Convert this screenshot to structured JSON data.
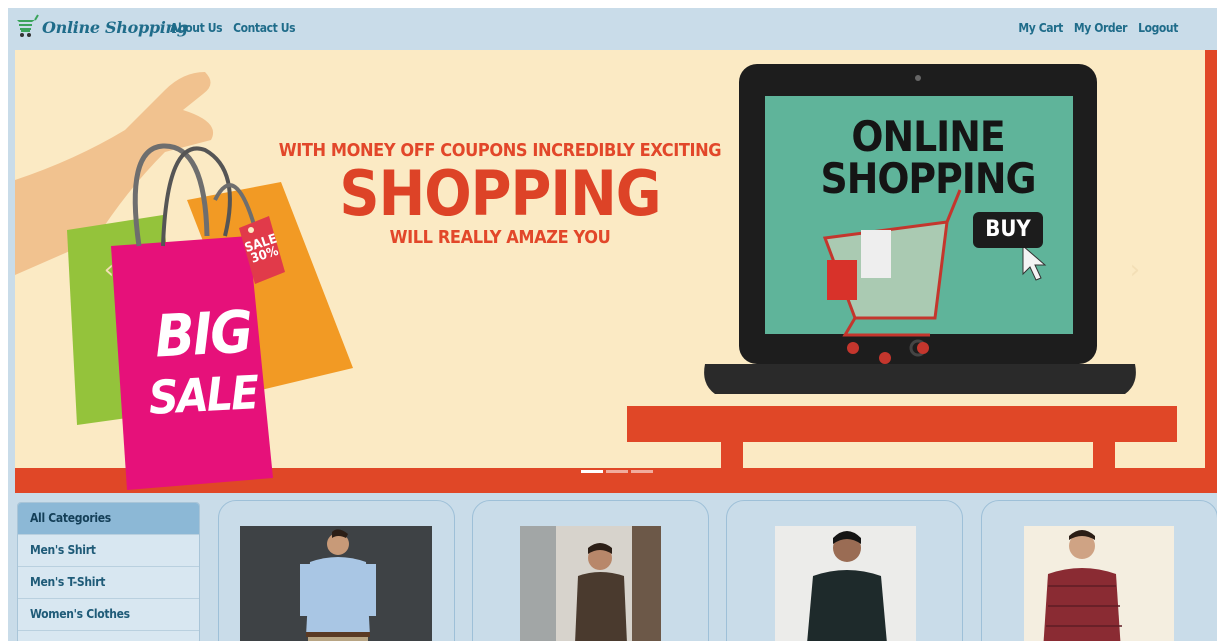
{
  "navbar": {
    "brand": "Online Shopping",
    "left_links": [
      "About Us",
      "Contact Us"
    ],
    "right_links": [
      "My Cart",
      "My Order",
      "Logout"
    ]
  },
  "carousel": {
    "promo_top": "WITH MONEY OFF COUPONS INCREDIBLY EXCITING",
    "promo_main": "SHOPPING",
    "promo_bottom": "WILL REALLY AMAZE YOU",
    "screen_line1": "ONLINE",
    "screen_line2": "SHOPPING",
    "buy_label": "BUY",
    "bag_line1": "BIG",
    "bag_line2": "SALE",
    "tag_line1": "SALE",
    "tag_line2": "30%",
    "prev_arrow": "‹",
    "next_arrow": "›",
    "slide_count": 3,
    "active_slide": 1
  },
  "sidebar": {
    "categories": [
      "All Categories",
      "Men's Shirt",
      "Men's T-Shirt",
      "Women's Clothes"
    ]
  },
  "products": [
    {
      "shirt_color": "#a9c6e4",
      "bg_color": "#3e4245"
    },
    {
      "shirt_color": "#4a3a2e",
      "bg_color": "#d7d3cc"
    },
    {
      "shirt_color": "#1e2a2b",
      "bg_color": "#ececea"
    },
    {
      "shirt_color": "#8a2b33",
      "bg_color": "#f4eee0"
    }
  ],
  "colors": {
    "navbar_bg": "#c9dce9",
    "brand": "#1f6c8a",
    "banner_bg": "#fbeac4",
    "promo_red": "#dd4327",
    "screen_green": "#5fb49a"
  }
}
